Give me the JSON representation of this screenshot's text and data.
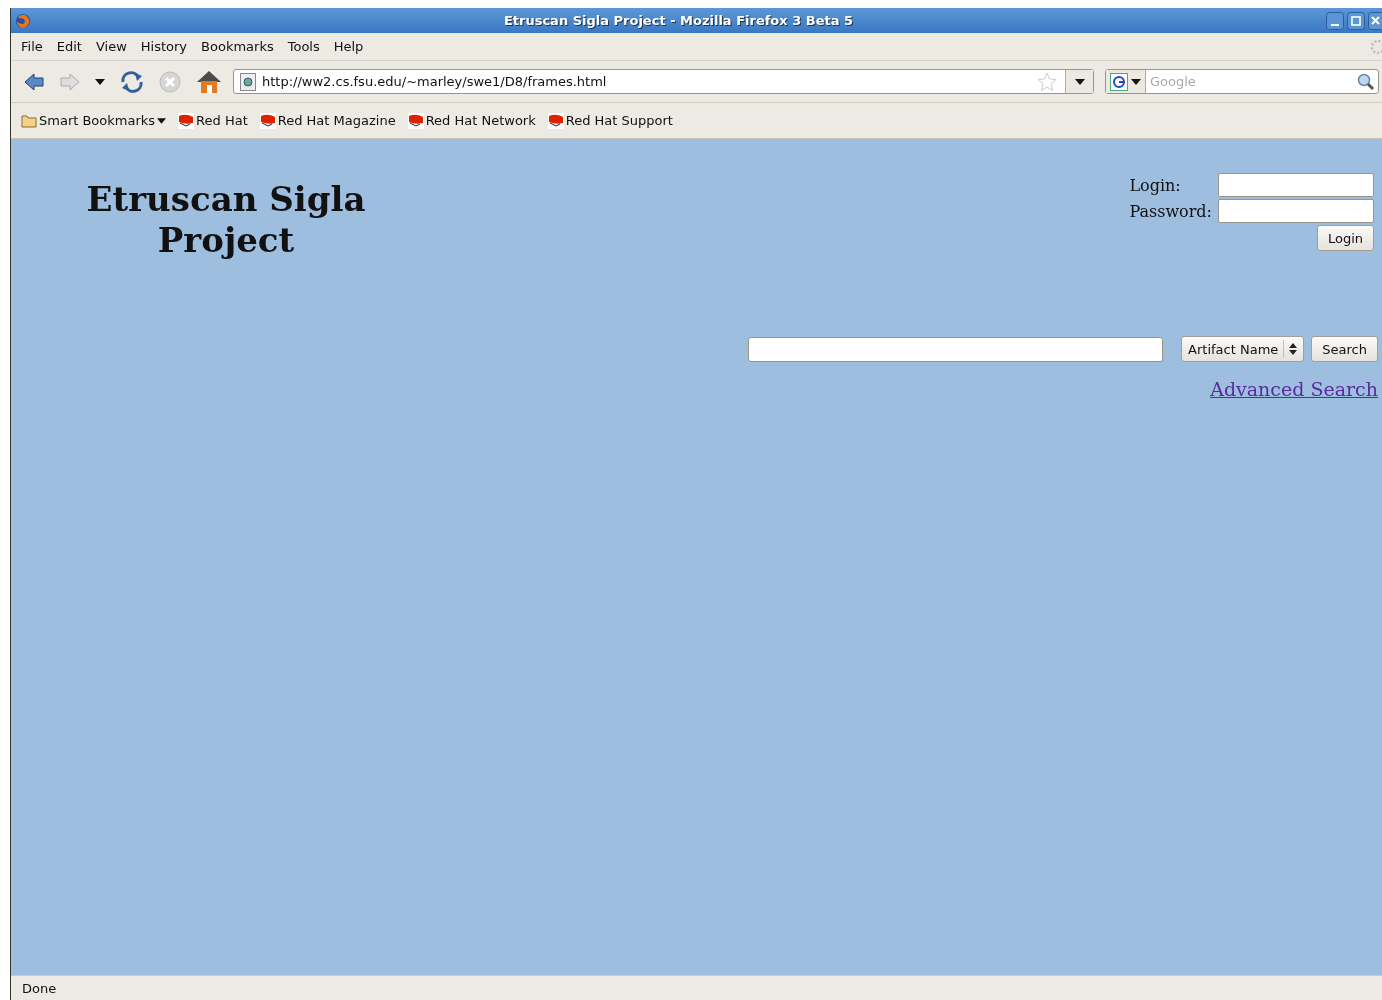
{
  "window": {
    "title": "Etruscan Sigla Project - Mozilla Firefox 3 Beta 5"
  },
  "menu": [
    "File",
    "Edit",
    "View",
    "History",
    "Bookmarks",
    "Tools",
    "Help"
  ],
  "address": {
    "value": "http://ww2.cs.fsu.edu/~marley/swe1/D8/frames.html"
  },
  "web_search": {
    "placeholder": "Google"
  },
  "bookmarks": [
    {
      "label": "Smart Bookmarks",
      "kind": "folder"
    },
    {
      "label": "Red Hat",
      "kind": "link"
    },
    {
      "label": "Red Hat Magazine",
      "kind": "link"
    },
    {
      "label": "Red Hat Network",
      "kind": "link"
    },
    {
      "label": "Red Hat Support",
      "kind": "link"
    }
  ],
  "page": {
    "heading": "Etruscan Sigla Project",
    "login": {
      "login_label": "Login:",
      "password_label": "Password:",
      "button": "Login"
    },
    "search": {
      "type_select": "Artifact Name",
      "button": "Search",
      "advanced_link": "Advanced Search"
    }
  },
  "status_bar": "Done"
}
